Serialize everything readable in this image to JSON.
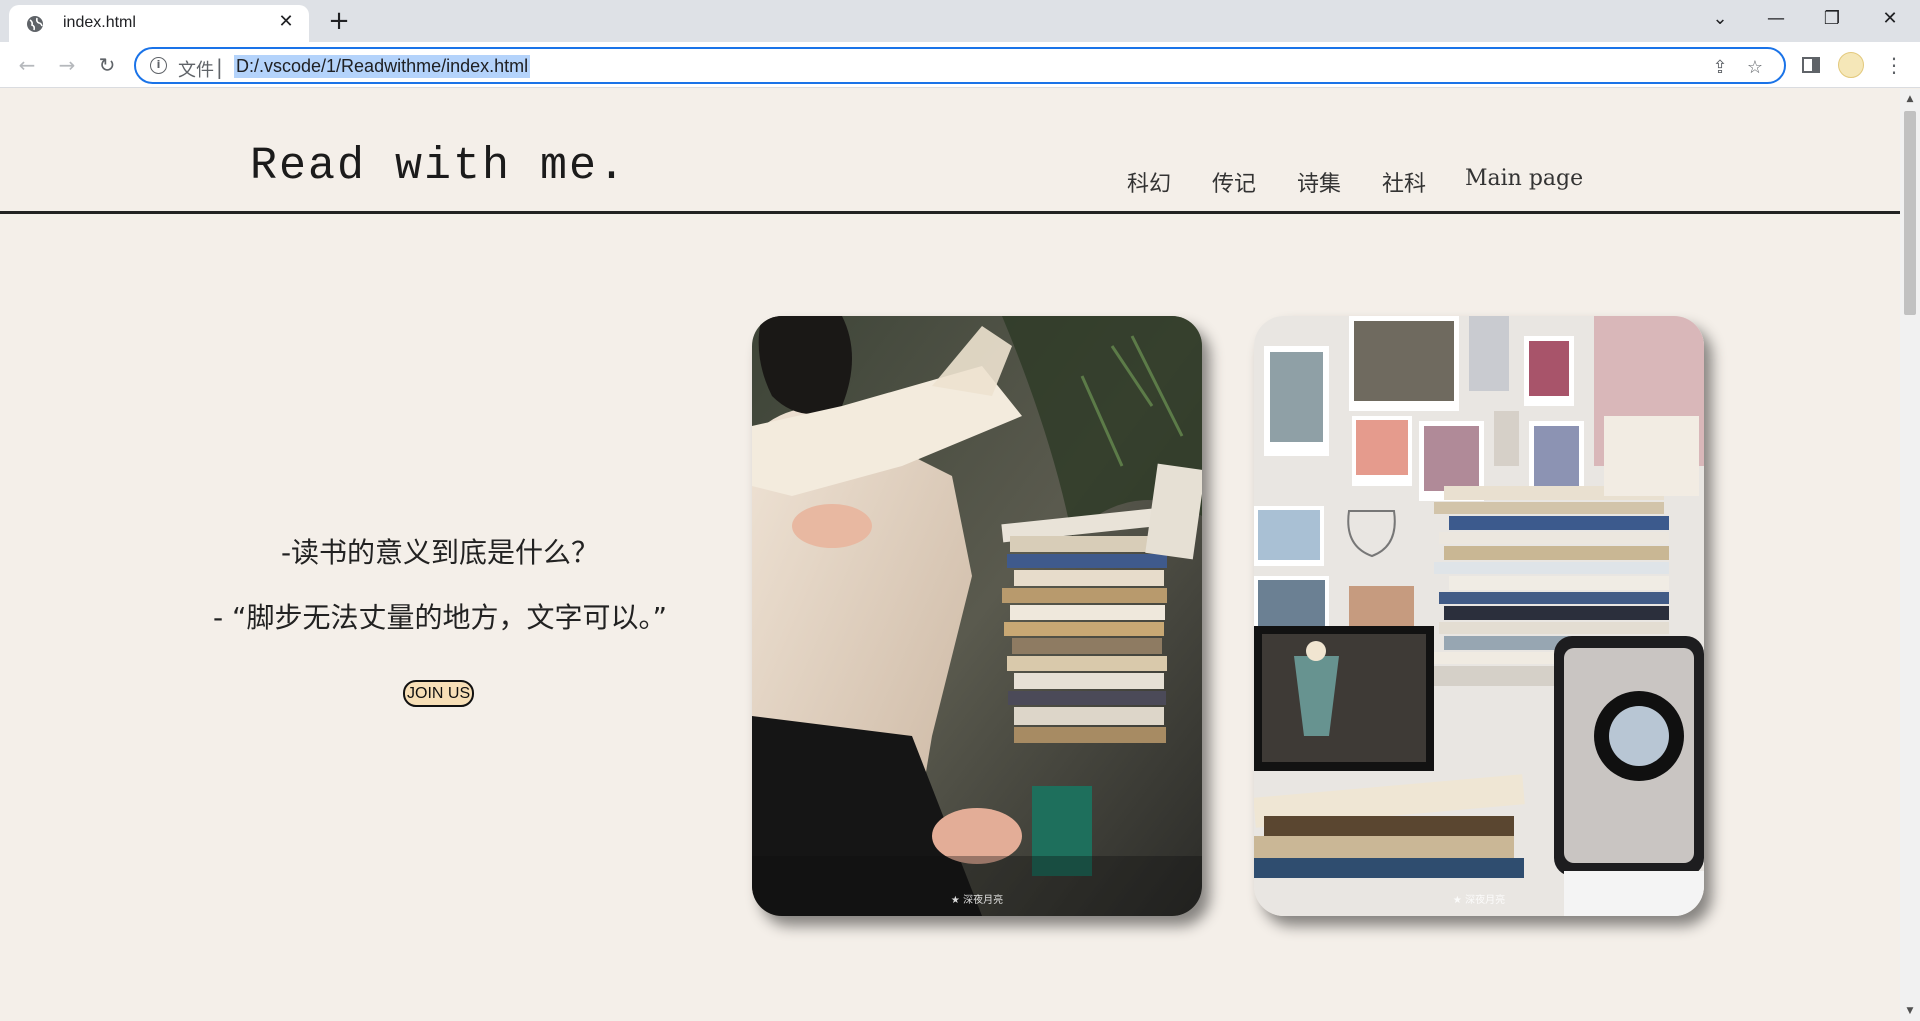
{
  "browser": {
    "tab_title": "index.html",
    "tab_close": "✕",
    "new_tab": "+",
    "window_controls": [
      "⌄",
      "—",
      "❐",
      "✕"
    ],
    "back": "←",
    "forward": "→",
    "reload": "↻",
    "scheme_label": "文件",
    "url": "D:/.vscode/1/Readwithme/index.html",
    "share": "⇪",
    "bookmark": "☆",
    "menu": "⋮"
  },
  "site": {
    "logo": "Read with me.",
    "nav": [
      "科幻",
      "传记",
      "诗集",
      "社科",
      "Main page"
    ],
    "question": "-读书的意义到底是什么？",
    "quote": "- “脚步无法丈量的地方，文字可以。”",
    "join_label": "JOIN US",
    "photos": [
      {
        "caption": "★ 深夜月亮",
        "alt": "person-reading-photo"
      },
      {
        "caption": "★ 深夜月亮",
        "alt": "bookshelf-desk-photo"
      }
    ]
  }
}
